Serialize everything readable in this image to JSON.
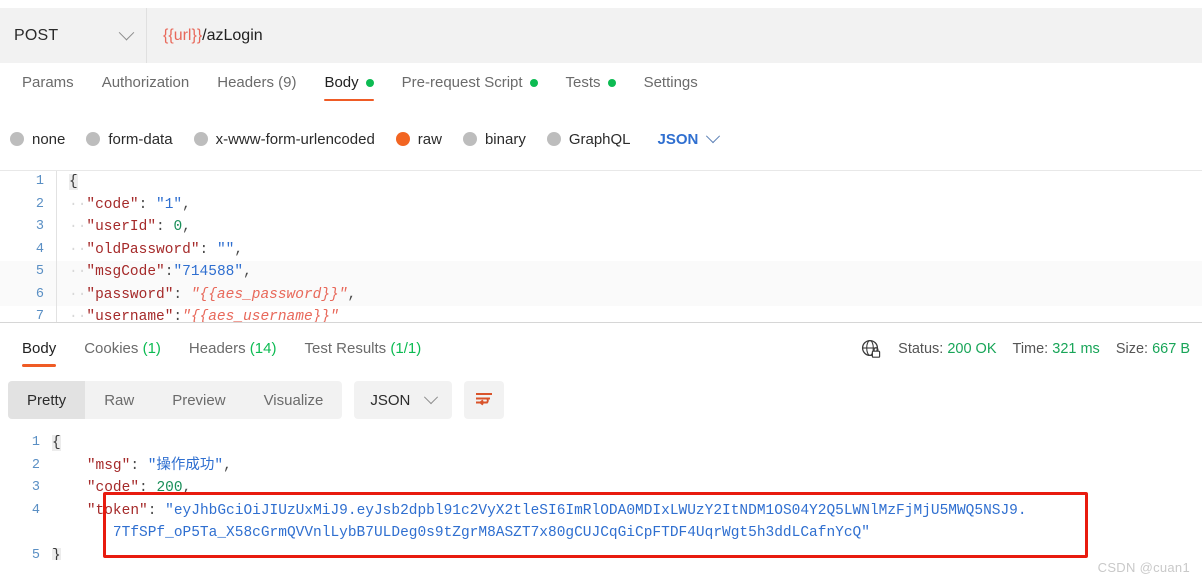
{
  "request": {
    "method": "POST",
    "url_variable": "{{url}}",
    "url_path": "/azLogin",
    "tabs": [
      {
        "label": "Params",
        "dot": false,
        "active": false
      },
      {
        "label": "Authorization",
        "dot": false,
        "active": false
      },
      {
        "label": "Headers (9)",
        "dot": false,
        "active": false
      },
      {
        "label": "Body",
        "dot": true,
        "active": true
      },
      {
        "label": "Pre-request Script",
        "dot": true,
        "active": false
      },
      {
        "label": "Tests",
        "dot": true,
        "active": false
      },
      {
        "label": "Settings",
        "dot": false,
        "active": false
      }
    ],
    "body_types": [
      {
        "label": "none",
        "selected": false
      },
      {
        "label": "form-data",
        "selected": false
      },
      {
        "label": "x-www-form-urlencoded",
        "selected": false
      },
      {
        "label": "raw",
        "selected": true
      },
      {
        "label": "binary",
        "selected": false
      },
      {
        "label": "GraphQL",
        "selected": false
      }
    ],
    "format_label": "JSON",
    "body_lines": [
      {
        "num": "1",
        "type": "brace",
        "text": "{"
      },
      {
        "num": "2",
        "key": "\"code\"",
        "sep": ": ",
        "value": "\"1\"",
        "vclass": "s",
        "tail": ","
      },
      {
        "num": "3",
        "key": "\"userId\"",
        "sep": ": ",
        "value": "0",
        "vclass": "n",
        "tail": ","
      },
      {
        "num": "4",
        "key": "\"oldPassword\"",
        "sep": ": ",
        "value": "\"\"",
        "vclass": "s",
        "tail": ","
      },
      {
        "num": "5",
        "key": "\"msgCode\"",
        "sep": ":",
        "value": "\"714588\"",
        "vclass": "s",
        "tail": ","
      },
      {
        "num": "6",
        "key": "\"password\"",
        "sep": ": ",
        "value": "\"{{aes_password}}\"",
        "vclass": "v",
        "tail": ","
      },
      {
        "num": "7",
        "key": "\"username\"",
        "sep": ":",
        "value": "\"{{aes_username}}\"",
        "vclass": "v",
        "tail": ""
      }
    ]
  },
  "response": {
    "tabs": [
      {
        "label": "Body",
        "count": "",
        "active": true
      },
      {
        "label": "Cookies",
        "count": "(1)",
        "active": false
      },
      {
        "label": "Headers",
        "count": "(14)",
        "active": false
      },
      {
        "label": "Test Results",
        "count": "(1/1)",
        "active": false
      }
    ],
    "meta": {
      "status_label": "Status:",
      "status_value": "200 OK",
      "time_label": "Time:",
      "time_value": "321 ms",
      "size_label": "Size:",
      "size_value": "667 B"
    },
    "view_modes": [
      {
        "label": "Pretty",
        "active": true
      },
      {
        "label": "Raw",
        "active": false
      },
      {
        "label": "Preview",
        "active": false
      },
      {
        "label": "Visualize",
        "active": false
      }
    ],
    "format_label": "JSON",
    "body_lines": [
      {
        "num": "1",
        "type": "brace",
        "text": "{"
      },
      {
        "num": "2",
        "key": "\"msg\"",
        "sep": ": ",
        "value": "\"操作成功\"",
        "vclass": "s",
        "tail": ","
      },
      {
        "num": "3",
        "key": "\"code\"",
        "sep": ": ",
        "value": "200",
        "vclass": "n",
        "tail": ","
      },
      {
        "num": "4",
        "key": "\"token\"",
        "sep": ": ",
        "value": "\"eyJhbGciOiJIUzUxMiJ9.eyJsb2dpbl91c2VyX2tleSI6ImRlODA0MDIxLWUzY2ItNDM1OS04Y2Q5LWNlMzFjMjU5MWQ5NSJ9.",
        "vclass": "s",
        "tail": ""
      },
      {
        "num": "",
        "type": "cont",
        "value": "7TfSPf_oP5Ta_X58cGrmQVVnlLybB7ULDeg0s9tZgrM8ASZT7x80gCUJCqGiCpFTDF4UqrWgt5h3ddLCafnYcQ\"",
        "vclass": "s"
      },
      {
        "num": "5",
        "type": "brace",
        "text": "}"
      }
    ]
  },
  "annotation": {
    "highlight_color": "#e81b0f"
  },
  "watermark": "CSDN @cuan1",
  "colors": {
    "accent": "#ef5b25",
    "radio_on": "#f26522",
    "green": "#0cbb52",
    "link_blue": "#2f6fd0"
  }
}
